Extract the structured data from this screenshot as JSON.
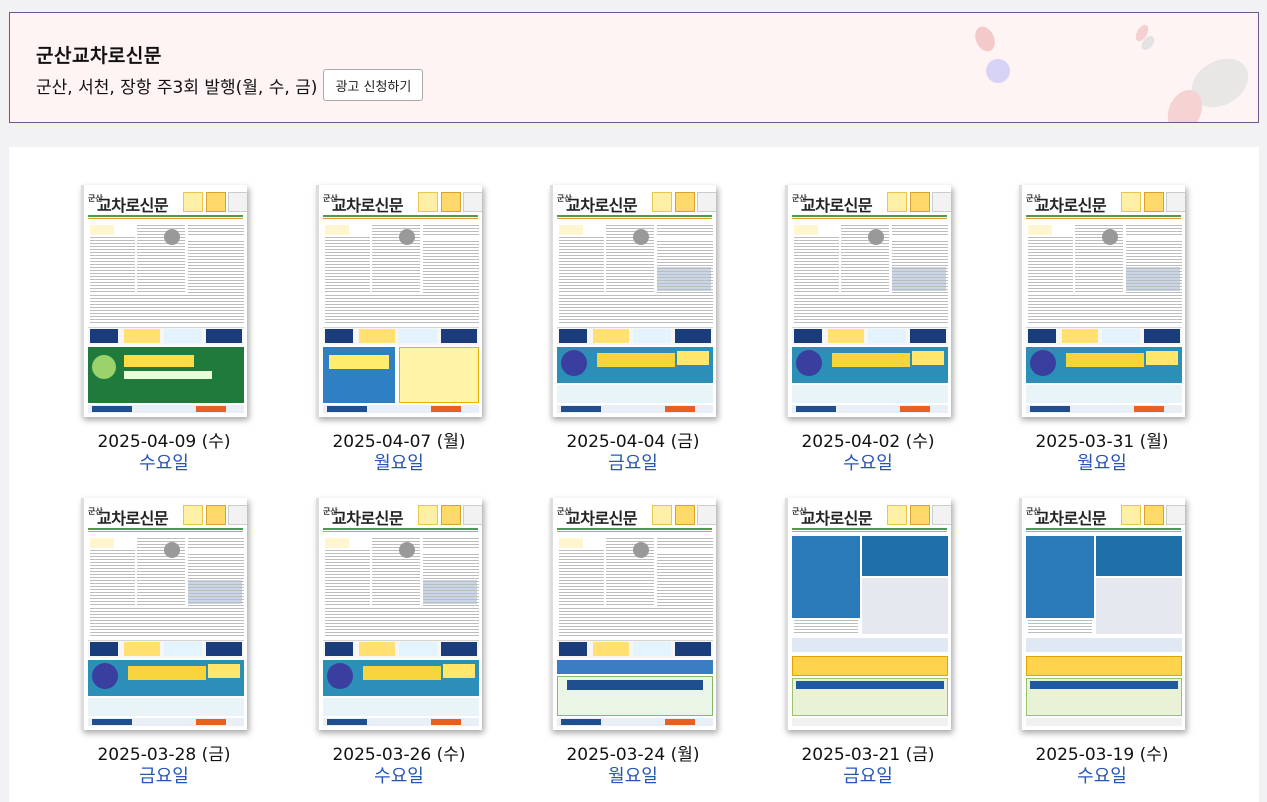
{
  "header": {
    "title": "군산교차로신문",
    "subtitle": "군산, 서천, 장항 주3회 발행(월, 수, 금)",
    "ad_button_label": "광고 신청하기"
  },
  "newspaper": {
    "logo_small": "군산",
    "logo": "교차로신문"
  },
  "colors": {
    "accent_blue": "#2756b5",
    "header_bg": "#fff4f4",
    "header_border": "#6b5a8e"
  },
  "issues": [
    {
      "date": "2025-04-09 (수)",
      "day": "수요일",
      "style": "a"
    },
    {
      "date": "2025-04-07 (월)",
      "day": "월요일",
      "style": "b"
    },
    {
      "date": "2025-04-04 (금)",
      "day": "금요일",
      "style": "c"
    },
    {
      "date": "2025-04-02 (수)",
      "day": "수요일",
      "style": "c"
    },
    {
      "date": "2025-03-31 (월)",
      "day": "월요일",
      "style": "c"
    },
    {
      "date": "2025-03-28 (금)",
      "day": "금요일",
      "style": "c"
    },
    {
      "date": "2025-03-26 (수)",
      "day": "수요일",
      "style": "c"
    },
    {
      "date": "2025-03-24 (월)",
      "day": "월요일",
      "style": "d"
    },
    {
      "date": "2025-03-21 (금)",
      "day": "금요일",
      "style": "e"
    },
    {
      "date": "2025-03-19 (수)",
      "day": "수요일",
      "style": "e"
    }
  ]
}
